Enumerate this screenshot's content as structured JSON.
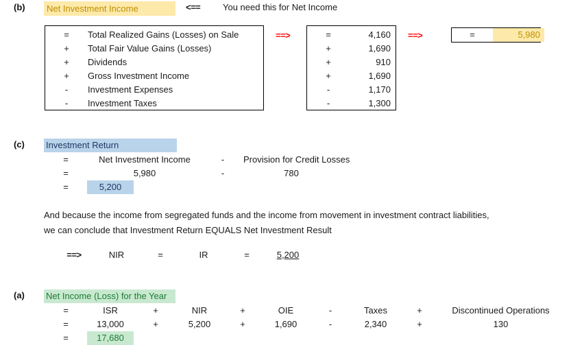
{
  "sections": {
    "b": {
      "marker": "(b)",
      "title": "Net Investment Income",
      "pointer": "<==",
      "note": "You need this for Net Income",
      "formula_rows": [
        {
          "op": "=",
          "label": "Total Realized Gains (Losses) on Sale"
        },
        {
          "op": "+",
          "label": "Total Fair Value Gains (Losses)"
        },
        {
          "op": "+",
          "label": "Dividends"
        },
        {
          "op": "+",
          "label": "Gross Investment Income"
        },
        {
          "op": "-",
          "label": "Investment Expenses"
        },
        {
          "op": "-",
          "label": "Investment Taxes"
        }
      ],
      "arrow1": "==>",
      "value_rows": [
        {
          "op": "=",
          "value": "4,160"
        },
        {
          "op": "+",
          "value": "1,690"
        },
        {
          "op": "+",
          "value": "910"
        },
        {
          "op": "+",
          "value": "1,690"
        },
        {
          "op": "-",
          "value": "1,170"
        },
        {
          "op": "-",
          "value": "1,300"
        }
      ],
      "arrow2": "==>",
      "result": {
        "op": "=",
        "value": "5,980"
      }
    },
    "c": {
      "marker": "(c)",
      "title": "Investment Return",
      "rows": [
        {
          "op": "=",
          "term1": "Net Investment Income",
          "op2": "-",
          "term2": "Provision for Credit Losses"
        },
        {
          "op": "=",
          "term1": "5,980",
          "op2": "-",
          "term2": "780"
        },
        {
          "op": "=",
          "term1": "5,200",
          "op2": "",
          "term2": ""
        }
      ],
      "paragraph_line1": "And because the income from segregated funds and the income from movement in investment contract liabilities,",
      "paragraph_line2": "we can conclude that Investment Return EQUALS Net Investment Result",
      "conclusion": {
        "arrow": "==>",
        "a": "NIR",
        "eq1": "=",
        "b": "IR",
        "eq2": "=",
        "value": "5,200"
      }
    },
    "a": {
      "marker": "(a)",
      "title": "Net Income (Loss) for the Year",
      "header_row": {
        "op": "=",
        "cells": [
          {
            "label": "ISR",
            "op_after": "+"
          },
          {
            "label": "NIR",
            "op_after": "+"
          },
          {
            "label": "OIE",
            "op_after": "-"
          },
          {
            "label": "Taxes",
            "op_after": "+"
          },
          {
            "label": "Discontinued Operations",
            "op_after": ""
          }
        ]
      },
      "value_row": {
        "op": "=",
        "cells": [
          {
            "label": "13,000",
            "op_after": "+"
          },
          {
            "label": "5,200",
            "op_after": "+"
          },
          {
            "label": "1,690",
            "op_after": "-"
          },
          {
            "label": "2,340",
            "op_after": "+"
          },
          {
            "label": "130",
            "op_after": ""
          }
        ]
      },
      "total_row": {
        "op": "=",
        "value": "17,680"
      }
    }
  },
  "colors": {
    "yellow_fill": "#fde9a9",
    "yellow_text": "#bf8f00",
    "blue_fill": "#b9d3ea",
    "blue_text": "#1f3864",
    "green_fill": "#c8e9d0",
    "green_text": "#1e7a34",
    "arrow_red": "#ff0000",
    "border": "#000000"
  }
}
